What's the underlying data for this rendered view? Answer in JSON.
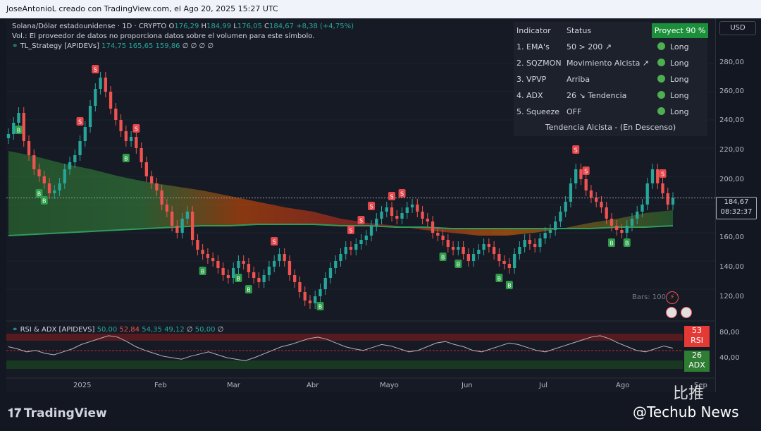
{
  "header": {
    "caption": "JoseAntonioL creado con TradingView.com, el Ago 20, 2025 15:27 UTC"
  },
  "legend": {
    "symbol": "Solana/Dólar estadounidense · 1D · CRYPTO",
    "o_label": "O",
    "o": "176,29",
    "h_label": "H",
    "h": "184,99",
    "l_label": "L",
    "l": "176,05",
    "c_label": "C",
    "c": "184,67",
    "change": "+8,38 (+4,75%)",
    "vol_note": "Vol.: El proveedor de datos no proporciona datos sobre el volumen para este símbolo.",
    "strategy_name": "TL_Strategy [APIDEVs]",
    "strategy_v1": "174,75",
    "strategy_v2": "165,65",
    "strategy_v3": "159,86",
    "strategy_rest": "∅ ∅ ∅ ∅"
  },
  "currency": "USD",
  "price_axis": {
    "ticks": [
      "280,00",
      "260,00",
      "240,00",
      "220,00",
      "200,00",
      "160,00",
      "140,00",
      "120,00"
    ],
    "current_price": "184,67",
    "countdown": "08:32:37"
  },
  "rsi_axis": {
    "ticks": [
      "80,00",
      "40,00"
    ]
  },
  "time_axis": {
    "ticks": [
      "2025",
      "Feb",
      "Mar",
      "Abr",
      "Mayo",
      "Jun",
      "Jul",
      "Ago",
      "Sep"
    ]
  },
  "indicator_table": {
    "col_indicator": "Indicator",
    "col_status": "Status",
    "projection": "Proyect 90 %",
    "rows": [
      {
        "name": "1. EMA's",
        "status": "50 > 200 ↗",
        "signal": "Long"
      },
      {
        "name": "2. SQZMON",
        "status": "Movimiento Alcista ↗",
        "signal": "Long"
      },
      {
        "name": "3. VPVP",
        "status": "Arriba",
        "signal": "Long"
      },
      {
        "name": "4. ADX",
        "status": "26 ↘ Tendencia",
        "signal": "Long"
      },
      {
        "name": "5. Squeeze",
        "status": "OFF",
        "signal": "Long"
      }
    ],
    "footer": "Tendencia Alcista - (En Descenso)"
  },
  "rsi_panel": {
    "name": "RSI & ADX [APIDEVS]",
    "v1": "50,00",
    "v2": "52,84",
    "v3": "54,35",
    "v4": "49,12",
    "v5": "∅",
    "v6": "50,00",
    "v7": "∅",
    "rsi_value": "53",
    "rsi_label": "RSI",
    "adx_value": "26",
    "adx_label": "ADX"
  },
  "bars_label": "Bars: 100",
  "logo_text": "TradingView",
  "watermark": "@Techub News",
  "watermark_cn": "比推",
  "colors": {
    "up": "#26a69a",
    "down": "#ef5350",
    "background": "#161a25",
    "signal_green": "#1b8f3a"
  },
  "chart_data": {
    "type": "candlestick",
    "title": "Solana/Dólar estadounidense · 1D · CRYPTO",
    "ylim": [
      100,
      295
    ],
    "x_ticks": [
      "2025",
      "Feb",
      "Mar",
      "Abr",
      "Mayo",
      "Jun",
      "Jul",
      "Ago",
      "Sep"
    ],
    "close_series": {
      "name": "SOL/USD",
      "values": [
        230,
        238,
        245,
        225,
        215,
        205,
        200,
        195,
        188,
        190,
        195,
        205,
        210,
        215,
        225,
        235,
        250,
        262,
        270,
        260,
        248,
        240,
        232,
        225,
        228,
        220,
        210,
        200,
        195,
        190,
        180,
        175,
        165,
        160,
        170,
        175,
        155,
        148,
        145,
        142,
        140,
        135,
        130,
        128,
        135,
        140,
        138,
        132,
        128,
        125,
        130,
        136,
        140,
        145,
        140,
        130,
        125,
        118,
        112,
        110,
        115,
        120,
        128,
        135,
        140,
        145,
        150,
        148,
        152,
        155,
        158,
        165,
        170,
        175,
        178,
        172,
        170,
        174,
        178,
        180,
        175,
        170,
        168,
        160,
        158,
        155,
        150,
        148,
        150,
        145,
        140,
        145,
        148,
        152,
        150,
        145,
        140,
        138,
        135,
        145,
        150,
        155,
        152,
        150,
        156,
        160,
        162,
        168,
        175,
        182,
        195,
        205,
        198,
        190,
        185,
        182,
        178,
        170,
        165,
        162,
        160,
        165,
        170,
        175,
        180,
        195,
        205,
        195,
        188,
        180,
        184.67
      ]
    },
    "ema_fast": {
      "name": "EMA 50",
      "values": [
        218,
        214,
        209,
        205,
        200,
        196,
        193,
        190,
        186,
        182,
        178,
        175,
        170,
        167,
        165,
        162,
        160,
        158,
        158,
        160,
        163,
        167,
        170,
        174,
        176
      ]
    },
    "ema_slow": {
      "name": "EMA 200",
      "values": [
        158,
        159,
        160,
        161,
        162,
        163,
        164,
        165,
        165,
        166,
        166,
        166,
        165,
        165,
        164,
        164,
        163,
        163,
        163,
        163,
        163,
        163,
        164,
        164,
        165
      ]
    },
    "signals": [
      {
        "type": "B",
        "x": 2
      },
      {
        "type": "B",
        "x": 6
      },
      {
        "type": "B",
        "x": 7
      },
      {
        "type": "S",
        "x": 14
      },
      {
        "type": "S",
        "x": 17
      },
      {
        "type": "B",
        "x": 23
      },
      {
        "type": "S",
        "x": 25
      },
      {
        "type": "B",
        "x": 38
      },
      {
        "type": "B",
        "x": 45
      },
      {
        "type": "B",
        "x": 47
      },
      {
        "type": "S",
        "x": 52
      },
      {
        "type": "B",
        "x": 61
      },
      {
        "type": "S",
        "x": 67
      },
      {
        "type": "S",
        "x": 69
      },
      {
        "type": "S",
        "x": 71
      },
      {
        "type": "S",
        "x": 75
      },
      {
        "type": "S",
        "x": 77
      },
      {
        "type": "B",
        "x": 85
      },
      {
        "type": "B",
        "x": 88
      },
      {
        "type": "B",
        "x": 96
      },
      {
        "type": "B",
        "x": 98
      },
      {
        "type": "S",
        "x": 111
      },
      {
        "type": "S",
        "x": 113
      },
      {
        "type": "B",
        "x": 118
      },
      {
        "type": "B",
        "x": 121
      },
      {
        "type": "S",
        "x": 128
      }
    ],
    "rsi": {
      "name": "RSI",
      "ylim": [
        20,
        90
      ],
      "values": [
        55,
        52,
        48,
        50,
        46,
        44,
        48,
        52,
        58,
        62,
        66,
        70,
        68,
        62,
        55,
        50,
        46,
        42,
        40,
        38,
        42,
        45,
        48,
        44,
        40,
        38,
        36,
        40,
        45,
        50,
        55,
        58,
        62,
        66,
        68,
        65,
        60,
        55,
        52,
        50,
        54,
        58,
        56,
        52,
        48,
        50,
        55,
        60,
        62,
        58,
        55,
        50,
        48,
        52,
        56,
        60,
        58,
        54,
        50,
        48,
        52,
        56,
        60,
        64,
        68,
        70,
        66,
        60,
        55,
        50,
        48,
        52,
        56,
        53
      ]
    },
    "adx_value": 26
  }
}
